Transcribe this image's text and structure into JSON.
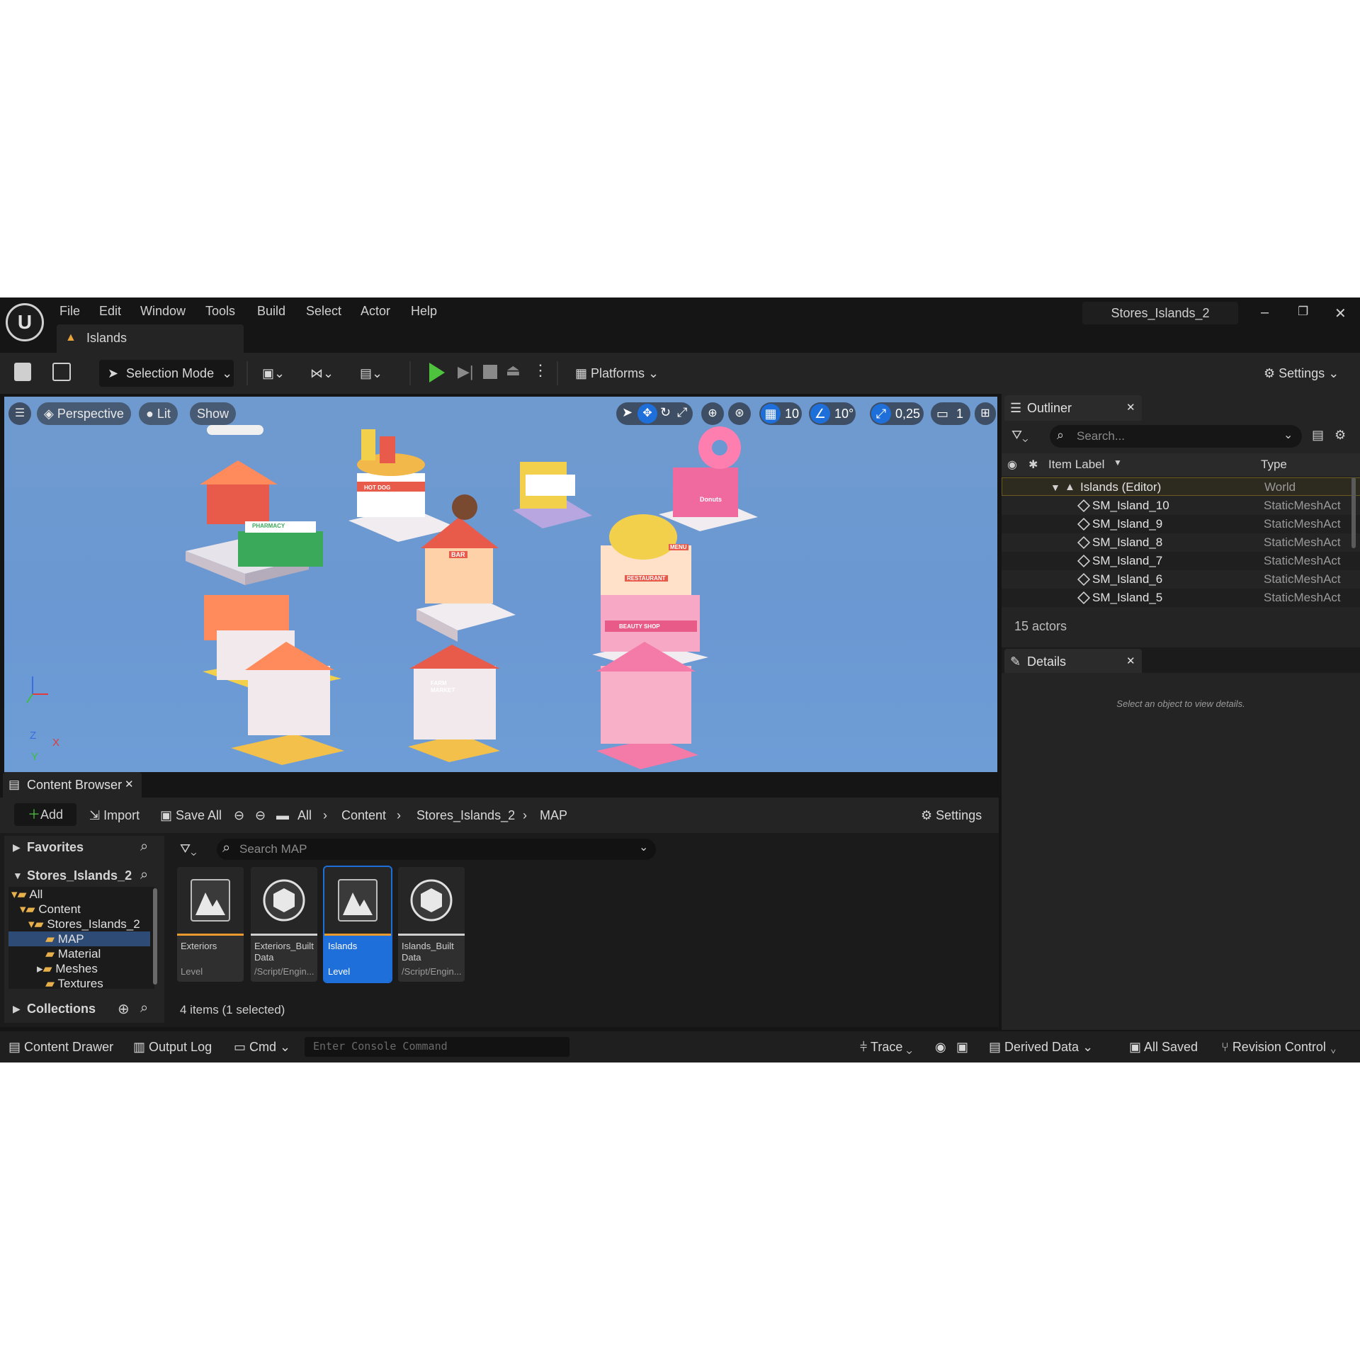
{
  "menu": [
    "File",
    "Edit",
    "Window",
    "Tools",
    "Build",
    "Select",
    "Actor",
    "Help"
  ],
  "level_tab": "Islands",
  "project_name": "Stores_Islands_2",
  "toolbar": {
    "selection_mode": "Selection Mode",
    "platforms": "Platforms",
    "settings": "Settings"
  },
  "viewport": {
    "perspective": "Perspective",
    "lit": "Lit",
    "show": "Show",
    "grid_snap": "10",
    "rotation_snap": "10°",
    "scale_snap": "0,25",
    "camera_speed": "1",
    "axis": {
      "z": "Z",
      "x": "X",
      "y": "Y"
    },
    "signs": [
      "HOT DOG",
      "BAR",
      "PHARMACY",
      "FARM MARKET",
      "RESTAURANT",
      "BEAUTY SHOP",
      "MENU",
      "Donuts"
    ]
  },
  "outliner": {
    "title": "Outliner",
    "search_placeholder": "Search...",
    "col_label": "Item Label",
    "col_type": "Type",
    "rows": [
      {
        "label": "Islands (Editor)",
        "type": "World"
      },
      {
        "label": "SM_Island_10",
        "type": "StaticMeshAct"
      },
      {
        "label": "SM_Island_9",
        "type": "StaticMeshAct"
      },
      {
        "label": "SM_Island_8",
        "type": "StaticMeshAct"
      },
      {
        "label": "SM_Island_7",
        "type": "StaticMeshAct"
      },
      {
        "label": "SM_Island_6",
        "type": "StaticMeshAct"
      },
      {
        "label": "SM_Island_5",
        "type": "StaticMeshAct"
      }
    ],
    "count": "15 actors"
  },
  "details": {
    "title": "Details",
    "empty": "Select an object to view details."
  },
  "content_browser": {
    "title": "Content Browser",
    "add": "Add",
    "import": "Import",
    "save_all": "Save All",
    "breadcrumb": [
      "All",
      "Content",
      "Stores_Islands_2",
      "MAP"
    ],
    "settings": "Settings",
    "favorites": "Favorites",
    "root": "Stores_Islands_2",
    "search_placeholder": "Search MAP",
    "tree": [
      "All",
      "Content",
      "Stores_Islands_2",
      "MAP",
      "Material",
      "Meshes",
      "Textures"
    ],
    "collections": "Collections",
    "assets": [
      {
        "name": "Exteriors",
        "type": "Level",
        "bar": "#e89a2e"
      },
      {
        "name": "Exteriors_Built Data",
        "type": "/Script/Engin...",
        "bar": "#cfcfcf"
      },
      {
        "name": "Islands",
        "type": "Level",
        "bar": "#e89a2e"
      },
      {
        "name": "Islands_Built Data",
        "type": "/Script/Engin...",
        "bar": "#cfcfcf"
      }
    ],
    "count": "4 items (1 selected)"
  },
  "statusbar": {
    "content_drawer": "Content Drawer",
    "output_log": "Output Log",
    "cmd": "Cmd",
    "console_placeholder": "Enter Console Command",
    "trace": "Trace",
    "derived_data": "Derived Data",
    "all_saved": "All Saved",
    "revision_control": "Revision Control"
  },
  "colors": {
    "accent": "#1e6fd9",
    "selected_row": "#2d3a52",
    "viewport_sky": "#6e9bd3"
  }
}
